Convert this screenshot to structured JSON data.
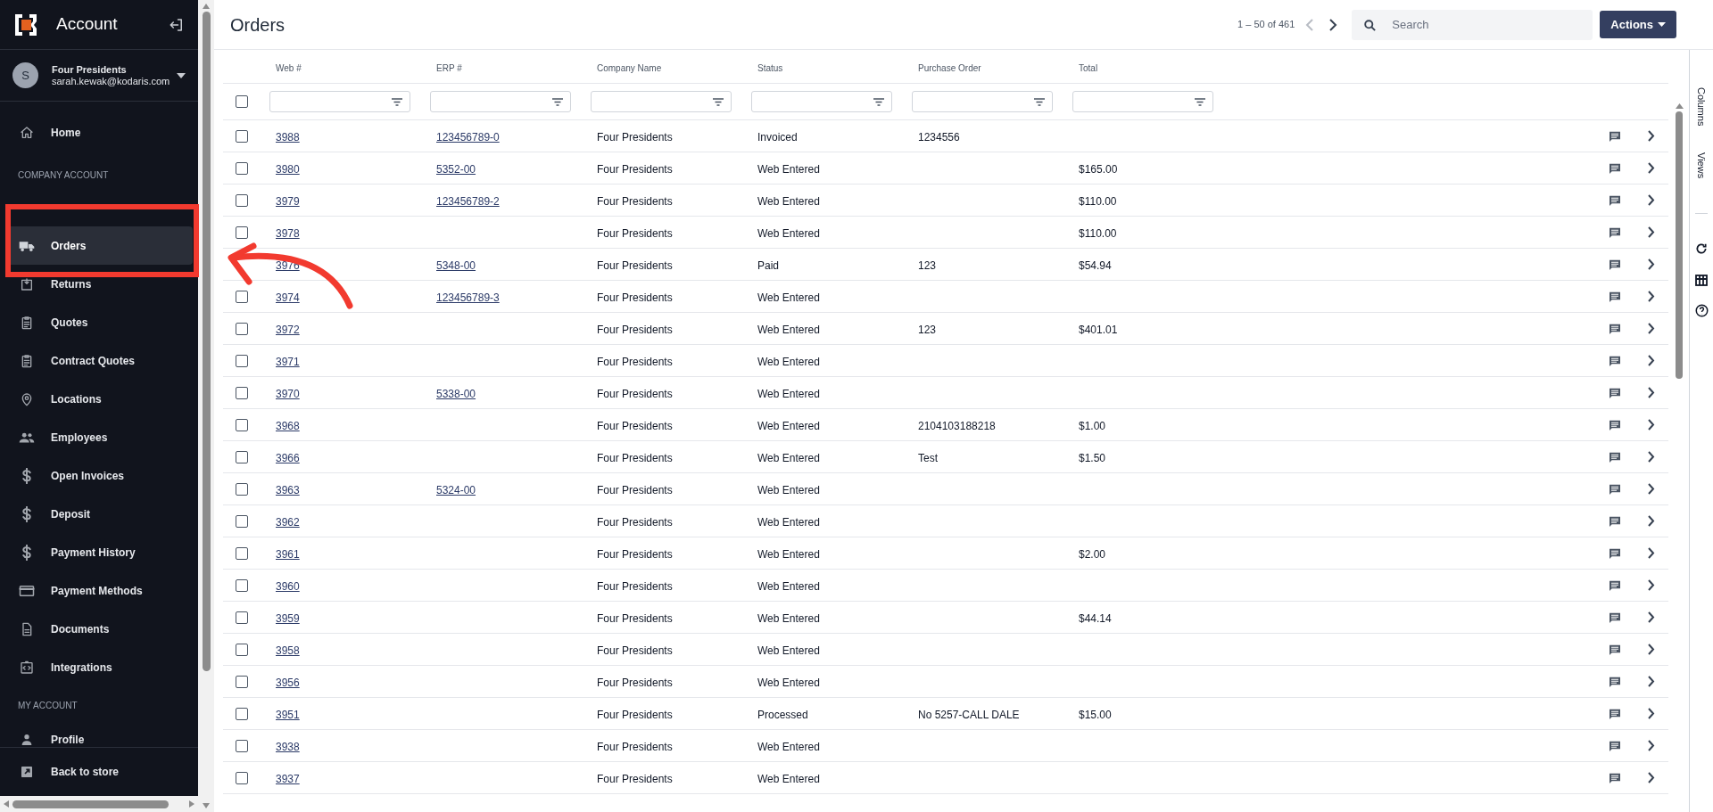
{
  "sidebar": {
    "title": "Account",
    "user": {
      "avatar": "S",
      "name": "Four Presidents",
      "email": "sarah.kewak@kodaris.com"
    },
    "sections": [
      {
        "items": [
          {
            "label": "Home",
            "selected": false
          }
        ]
      },
      {
        "heading": "COMPANY ACCOUNT",
        "items": [
          {
            "label": "Orders",
            "selected": true
          },
          {
            "label": "Returns",
            "selected": false
          },
          {
            "label": "Quotes",
            "selected": false
          },
          {
            "label": "Contract Quotes",
            "selected": false
          },
          {
            "label": "Locations",
            "selected": false
          },
          {
            "label": "Employees",
            "selected": false
          },
          {
            "label": "Open Invoices",
            "selected": false
          },
          {
            "label": "Deposit",
            "selected": false
          },
          {
            "label": "Payment History",
            "selected": false
          },
          {
            "label": "Payment Methods",
            "selected": false
          },
          {
            "label": "Documents",
            "selected": false
          },
          {
            "label": "Integrations",
            "selected": false
          }
        ]
      },
      {
        "heading": "MY ACCOUNT",
        "items": [
          {
            "label": "Profile",
            "selected": false
          }
        ]
      }
    ],
    "footer": {
      "label": "Back to store"
    }
  },
  "page": {
    "title": "Orders",
    "pagination": "1 – 50 of 461",
    "search": {
      "placeholder": "Search"
    },
    "actions": "Actions"
  },
  "table": {
    "columns": [
      "Web #",
      "ERP #",
      "Company Name",
      "Status",
      "Purchase Order",
      "Total"
    ],
    "select_all": {
      "checked": false
    },
    "rows": [
      {
        "checked": false,
        "web": "3988",
        "erp": "123456789-0",
        "company": "Four Presidents",
        "status": "Invoiced",
        "po": "1234556"
      },
      {
        "checked": false,
        "web": "3980",
        "erp": "5352-00",
        "company": "Four Presidents",
        "status": "Web Entered",
        "total": "$165.00"
      },
      {
        "checked": false,
        "web": "3979",
        "erp": "123456789-2",
        "company": "Four Presidents",
        "status": "Web Entered",
        "total": "$110.00"
      },
      {
        "checked": false,
        "web": "3978",
        "company": "Four Presidents",
        "status": "Web Entered",
        "total": "$110.00"
      },
      {
        "web": "3976",
        "erp": "5348-00",
        "company": "Four Presidents",
        "status": "Paid",
        "po": "123",
        "total": "$54.94"
      },
      {
        "checked": false,
        "web": "3974",
        "erp": "123456789-3",
        "company": "Four Presidents",
        "status": "Web Entered"
      },
      {
        "checked": false,
        "web": "3972",
        "company": "Four Presidents",
        "status": "Web Entered",
        "po": "123",
        "total": "$401.01"
      },
      {
        "checked": false,
        "web": "3971",
        "company": "Four Presidents",
        "status": "Web Entered"
      },
      {
        "checked": false,
        "web": "3970",
        "erp": "5338-00",
        "company": "Four Presidents",
        "status": "Web Entered"
      },
      {
        "checked": false,
        "web": "3968",
        "company": "Four Presidents",
        "status": "Web Entered",
        "po": "2104103188218",
        "total": "$1.00"
      },
      {
        "checked": false,
        "web": "3966",
        "company": "Four Presidents",
        "status": "Web Entered",
        "po": "Test",
        "total": "$1.50"
      },
      {
        "checked": false,
        "web": "3963",
        "erp": "5324-00",
        "company": "Four Presidents",
        "status": "Web Entered"
      },
      {
        "checked": false,
        "web": "3962",
        "company": "Four Presidents",
        "status": "Web Entered"
      },
      {
        "checked": false,
        "web": "3961",
        "company": "Four Presidents",
        "status": "Web Entered",
        "total": "$2.00"
      },
      {
        "checked": false,
        "web": "3960",
        "company": "Four Presidents",
        "status": "Web Entered"
      },
      {
        "checked": false,
        "web": "3959",
        "company": "Four Presidents",
        "status": "Web Entered",
        "total": "$44.14"
      },
      {
        "checked": false,
        "web": "3958",
        "company": "Four Presidents",
        "status": "Web Entered"
      },
      {
        "checked": false,
        "web": "3956",
        "company": "Four Presidents",
        "status": "Web Entered"
      },
      {
        "checked": false,
        "web": "3951",
        "company": "Four Presidents",
        "status": "Processed",
        "po": "No 5257-CALL DALE",
        "total": "$15.00"
      },
      {
        "checked": false,
        "web": "3938",
        "company": "Four Presidents",
        "status": "Web Entered"
      },
      {
        "checked": false,
        "web": "3937",
        "company": "Four Presidents",
        "status": "Web Entered"
      }
    ]
  },
  "side_panel": {
    "tabs": [
      "Columns",
      "Views"
    ]
  }
}
